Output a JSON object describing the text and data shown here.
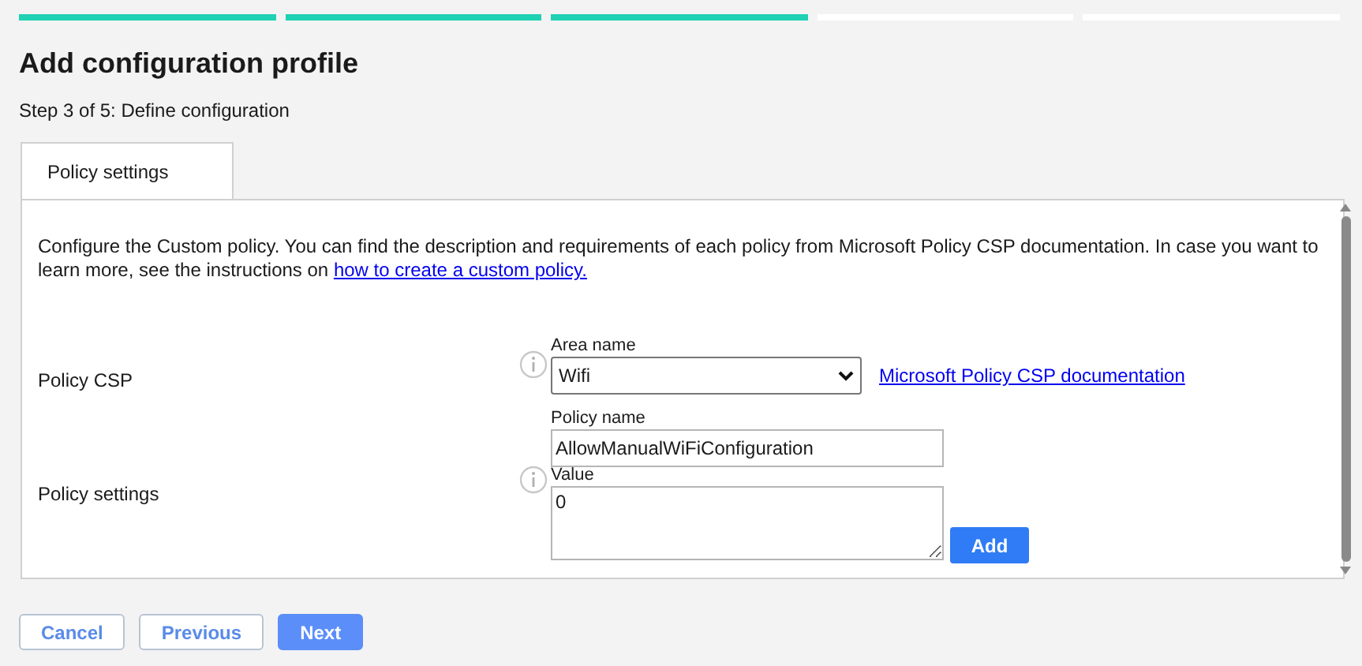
{
  "progress_steps": [
    {
      "completed": true
    },
    {
      "completed": true
    },
    {
      "completed": true
    },
    {
      "completed": false
    },
    {
      "completed": false
    }
  ],
  "title": "Add configuration profile",
  "subtitle": "Step 3 of 5: Define configuration",
  "tabs": [
    {
      "label": "Policy settings",
      "selected": true
    }
  ],
  "description": {
    "text": "Configure the Custom policy. You can find the description and requirements of each policy from Microsoft Policy CSP documentation. In case you want to learn more, see the instructions on ",
    "link": "how to create a custom policy."
  },
  "policy_csp": {
    "label": "Policy CSP",
    "area_name": {
      "label": "Area name",
      "value": "Wifi"
    },
    "doc_link": "Microsoft Policy CSP documentation",
    "policy_name": {
      "label": "Policy name",
      "value": "AllowManualWiFiConfiguration"
    }
  },
  "policy_settings": {
    "label": "Policy settings",
    "value_field": {
      "label": "Value",
      "value": "0"
    },
    "add_button": "Add"
  },
  "footer_buttons": [
    {
      "label": "Cancel",
      "kind": "secondary"
    },
    {
      "label": "Previous",
      "kind": "secondary"
    },
    {
      "label": "Next",
      "kind": "primary"
    }
  ]
}
